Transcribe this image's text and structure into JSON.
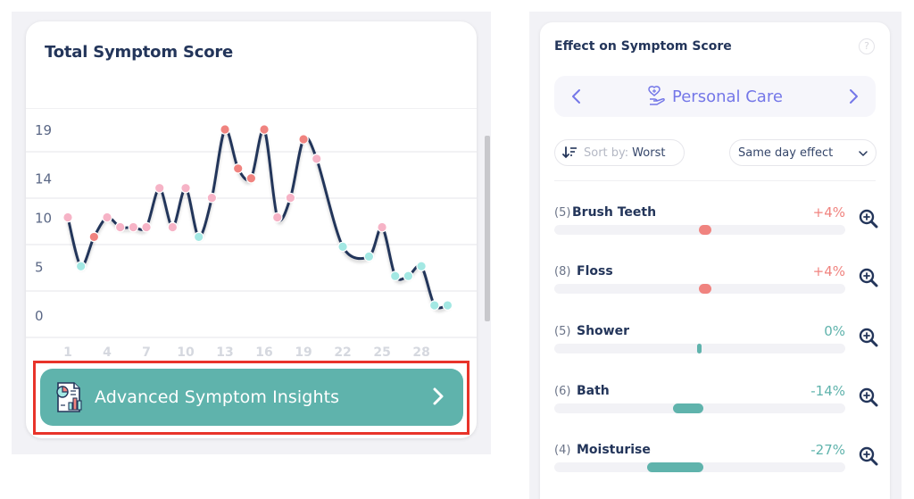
{
  "colors": {
    "line": "#23355a",
    "point_high": "#f0837f",
    "point_mid": "#f6b3c6",
    "point_low": "#a3e8e3",
    "positive_effect": "#f0837f",
    "negative_effect": "#5fb3ac",
    "accent_purple": "#7477e8",
    "teal_button": "#5fb3ac",
    "highlight_outline": "#e8332a"
  },
  "left_card": {
    "title": "Total Symptom Score",
    "insights_button": {
      "label": "Advanced Symptom Insights",
      "icon": "report-chart-icon",
      "chevron": "chevron-right-icon"
    }
  },
  "chart_data": {
    "type": "line",
    "title": "Total Symptom Score",
    "xlabel": "",
    "ylabel": "",
    "x_ticks": [
      "1",
      "4",
      "7",
      "10",
      "13",
      "16",
      "19",
      "22",
      "25",
      "28"
    ],
    "y_ticks": [
      "19",
      "14",
      "10",
      "5",
      "0"
    ],
    "ylim": [
      0,
      19
    ],
    "xlim": [
      1,
      30
    ],
    "grid": true,
    "legend": "none",
    "series": [
      {
        "name": "Total Symptom Score",
        "points": [
          {
            "x": 1,
            "y": 10,
            "level": "mid"
          },
          {
            "x": 2,
            "y": 5,
            "level": "low"
          },
          {
            "x": 3,
            "y": 8,
            "level": "high"
          },
          {
            "x": 4,
            "y": 10,
            "level": "mid"
          },
          {
            "x": 5,
            "y": 9,
            "level": "mid"
          },
          {
            "x": 6,
            "y": 9,
            "level": "mid"
          },
          {
            "x": 7,
            "y": 9,
            "level": "mid"
          },
          {
            "x": 8,
            "y": 13,
            "level": "mid"
          },
          {
            "x": 9,
            "y": 9,
            "level": "mid"
          },
          {
            "x": 10,
            "y": 13,
            "level": "mid"
          },
          {
            "x": 11,
            "y": 8,
            "level": "low"
          },
          {
            "x": 12,
            "y": 12,
            "level": "mid"
          },
          {
            "x": 13,
            "y": 19,
            "level": "high"
          },
          {
            "x": 14,
            "y": 15,
            "level": "high"
          },
          {
            "x": 15,
            "y": 14,
            "level": "high"
          },
          {
            "x": 16,
            "y": 19,
            "level": "high"
          },
          {
            "x": 17,
            "y": 10,
            "level": "mid"
          },
          {
            "x": 18,
            "y": 12,
            "level": "mid"
          },
          {
            "x": 19,
            "y": 18,
            "level": "high"
          },
          {
            "x": 20,
            "y": 16,
            "level": "mid"
          },
          {
            "x": 22,
            "y": 7,
            "level": "low"
          },
          {
            "x": 24,
            "y": 6,
            "level": "low"
          },
          {
            "x": 25,
            "y": 9,
            "level": "mid"
          },
          {
            "x": 26,
            "y": 4,
            "level": "low"
          },
          {
            "x": 27,
            "y": 4,
            "level": "low"
          },
          {
            "x": 28,
            "y": 5,
            "level": "low"
          },
          {
            "x": 29,
            "y": 1,
            "level": "low"
          },
          {
            "x": 30,
            "y": 1,
            "level": "low"
          }
        ]
      }
    ]
  },
  "right_card": {
    "title": "Effect on Symptom Score",
    "help_icon": "?",
    "category": {
      "label": "Personal Care",
      "icon": "heart-hand-icon"
    },
    "sort": {
      "prefix": "Sort by:",
      "value": "Worst"
    },
    "effect_filter": {
      "selected": "Same day effect"
    },
    "items": [
      {
        "count": "(5)",
        "name": "Brush Teeth",
        "effect_label": "+4%",
        "effect": 4
      },
      {
        "count": "(8)",
        "name": "Floss",
        "effect_label": "+4%",
        "effect": 4
      },
      {
        "count": "(5)",
        "name": "Shower",
        "effect_label": "0%",
        "effect": 0
      },
      {
        "count": "(6)",
        "name": "Bath",
        "effect_label": "-14%",
        "effect": -14
      },
      {
        "count": "(4)",
        "name": "Moisturise",
        "effect_label": "-27%",
        "effect": -27
      }
    ]
  }
}
